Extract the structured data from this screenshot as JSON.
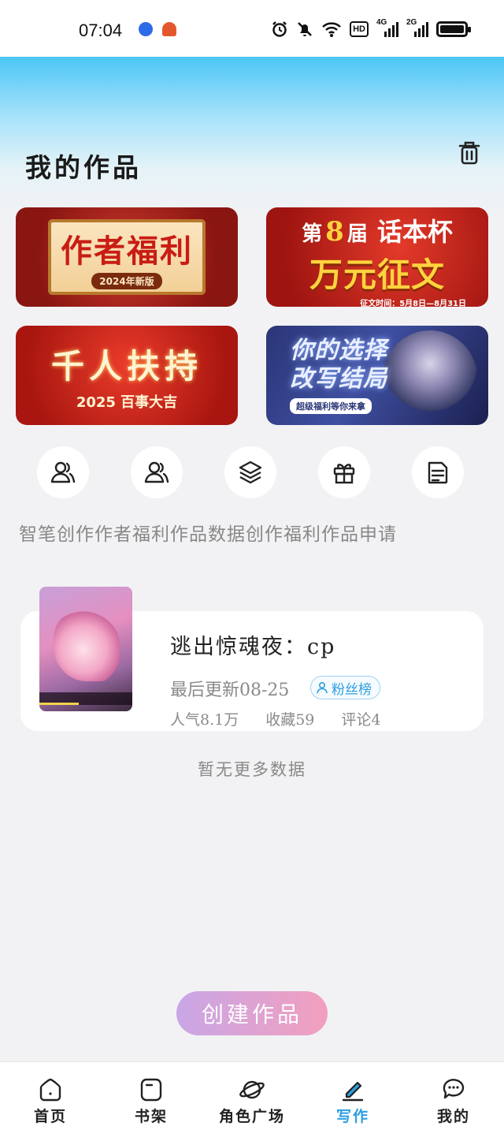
{
  "status_bar": {
    "time": "07:04",
    "network_label": "HD",
    "signal_1": "4G",
    "signal_2": "2G"
  },
  "header": {
    "title": "我的作品",
    "trash_icon": "trash-icon"
  },
  "banners": [
    {
      "title": "作者福利",
      "subtitle": "2024年新版"
    },
    {
      "line1_a": "第",
      "line1_num": "8",
      "line1_b": "届",
      "line1_c": "话本杯",
      "line2": "万元征文",
      "line3": "征文时间：5月8日—8月31日"
    },
    {
      "title": "千人扶持",
      "subtitle": "2025 百事大吉"
    },
    {
      "title": "你的选择改写结局",
      "subtitle": "超级福利等你来拿"
    }
  ],
  "quick_actions": [
    {
      "label": "智笔创作",
      "icon": "user-pen-icon"
    },
    {
      "label": "作者福利",
      "icon": "users-icon"
    },
    {
      "label": "作品数据",
      "icon": "layers-icon"
    },
    {
      "label": "创作福利",
      "icon": "gift-icon"
    },
    {
      "label": "作品申请",
      "icon": "document-icon"
    }
  ],
  "work": {
    "title": "逃出惊魂夜：cp",
    "updated": "最后更新08-25",
    "badge": "粉丝榜",
    "popularity": "人气8.1万",
    "favorites": "收藏59",
    "comments": "评论4"
  },
  "list_end_text": "暂无更多数据",
  "create_button": "创建作品",
  "tabs": [
    {
      "label": "首页",
      "icon": "home-icon"
    },
    {
      "label": "书架",
      "icon": "bookshelf-icon"
    },
    {
      "label": "角色广场",
      "icon": "planet-icon"
    },
    {
      "label": "写作",
      "icon": "pen-icon",
      "active": true
    },
    {
      "label": "我的",
      "icon": "chat-icon"
    }
  ],
  "colors": {
    "accent": "#2d9ee0",
    "create_gradient_start": "#c9a6e6",
    "create_gradient_end": "#f29fbe",
    "header_gradient": "#4cc6f6"
  }
}
